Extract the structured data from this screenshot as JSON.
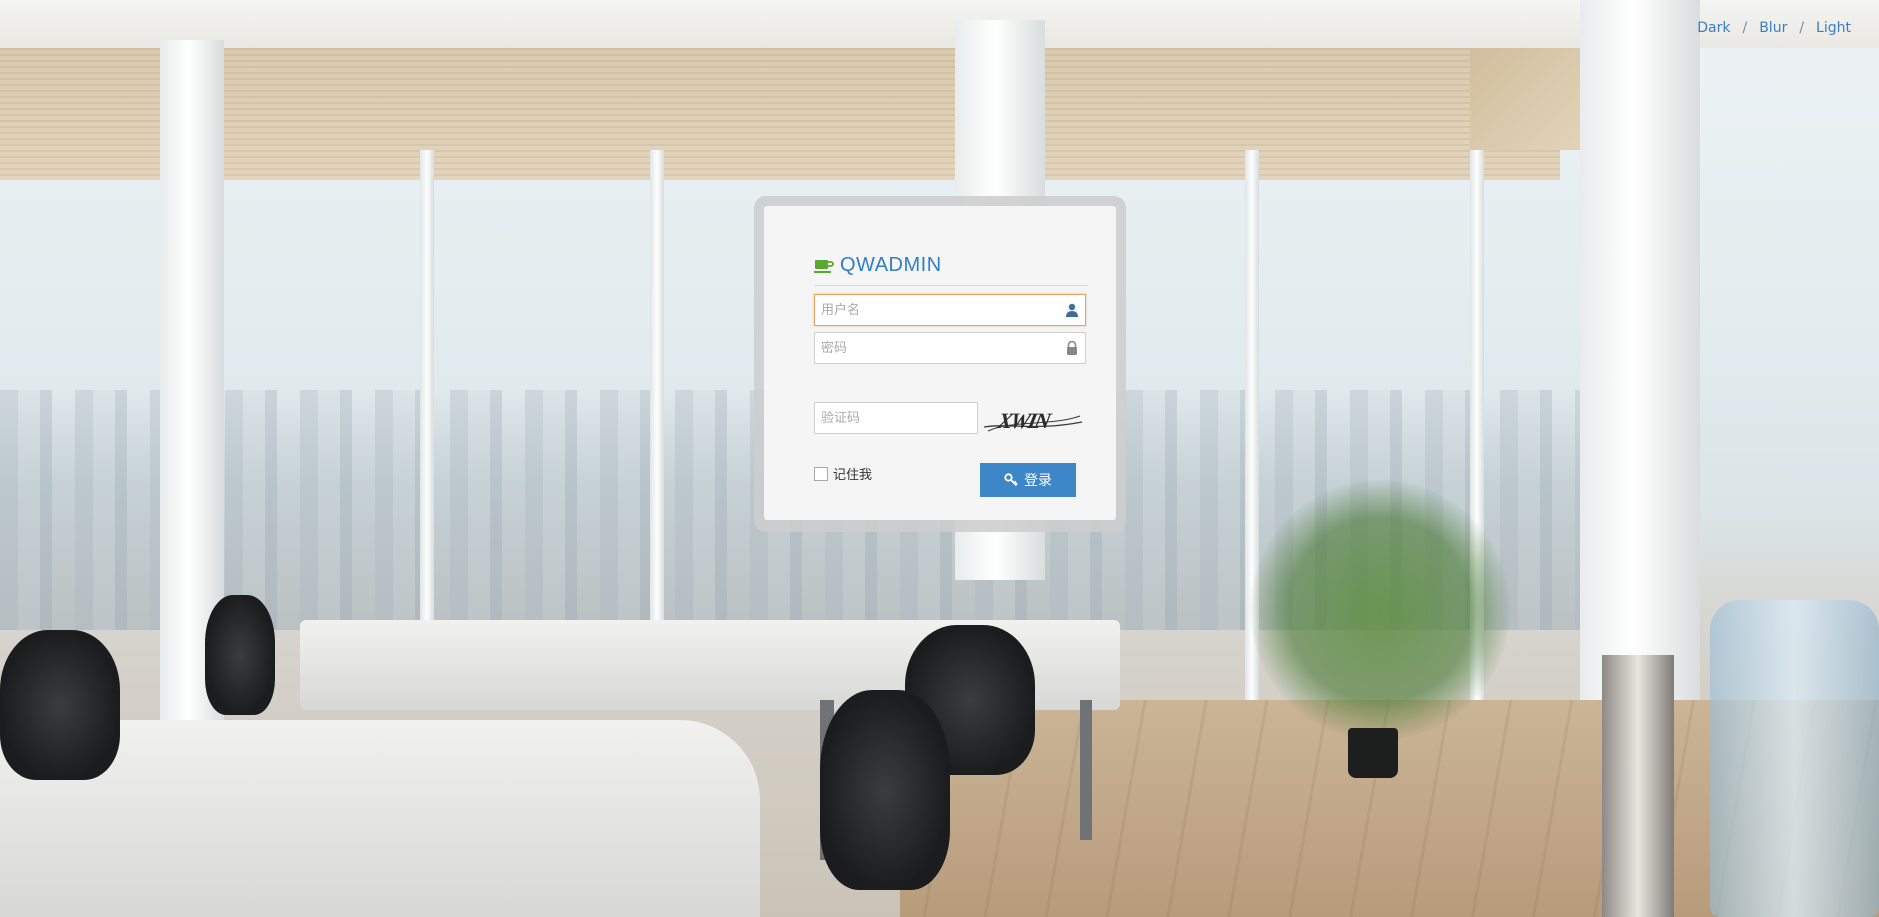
{
  "theme_switch": {
    "options": [
      "Dark",
      "Blur",
      "Light"
    ],
    "separator": "/"
  },
  "login": {
    "brand": "QWADMIN",
    "username_placeholder": "用户名",
    "password_placeholder": "密码",
    "captcha_placeholder": "验证码",
    "captcha_text": "XWIN",
    "remember_label": "记住我",
    "submit_label": "登录"
  },
  "icons": {
    "brand": "coffee-cup-icon",
    "username": "user-icon",
    "password": "lock-icon",
    "submit": "key-icon"
  },
  "colors": {
    "accent": "#2f7ec7",
    "button": "#3d86c8",
    "focus_border": "#e8a05a",
    "brand_icon": "#5aa832"
  }
}
